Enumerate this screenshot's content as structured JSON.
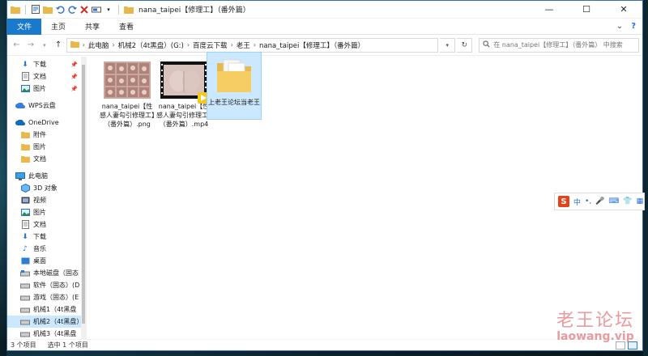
{
  "window": {
    "title": "nana_taipei【修理工】（番外篇）",
    "controls": {
      "minimize": "—",
      "maximize": "☐",
      "close": "✕"
    }
  },
  "ribbon": {
    "tabs": [
      {
        "label": "文件"
      },
      {
        "label": "主页"
      },
      {
        "label": "共享"
      },
      {
        "label": "查看"
      }
    ]
  },
  "address": {
    "breadcrumbs": [
      "此电脑",
      "机械2（4t黑盘）(G:)",
      "百度云下载",
      "老王",
      "nana_taipei【修理工】（番外篇）"
    ],
    "search_placeholder": "在 nana_taipei【修理工】（番外篇） 中搜索"
  },
  "sidebar": {
    "items": [
      {
        "label": "下载",
        "icon": "download-icon",
        "pinned": true
      },
      {
        "label": "文档",
        "icon": "document-icon",
        "pinned": true
      },
      {
        "label": "图片",
        "icon": "picture-icon",
        "pinned": true
      },
      {
        "label": "WPS云盘",
        "icon": "cloud-icon"
      },
      {
        "label": "OneDrive",
        "icon": "onedrive-icon"
      },
      {
        "label": "附件",
        "icon": "folder-icon"
      },
      {
        "label": "图片",
        "icon": "folder-icon"
      },
      {
        "label": "文档",
        "icon": "folder-icon"
      },
      {
        "label": "此电脑",
        "icon": "computer-icon"
      },
      {
        "label": "3D 对象",
        "icon": "3d-objects-icon"
      },
      {
        "label": "视频",
        "icon": "video-icon"
      },
      {
        "label": "图片",
        "icon": "picture-icon"
      },
      {
        "label": "文档",
        "icon": "document-icon"
      },
      {
        "label": "下载",
        "icon": "download-icon"
      },
      {
        "label": "音乐",
        "icon": "music-icon"
      },
      {
        "label": "桌面",
        "icon": "desktop-icon"
      },
      {
        "label": "本地磁盘（固态",
        "icon": "drive-icon"
      },
      {
        "label": "软件（固态）(D",
        "icon": "drive-icon"
      },
      {
        "label": "游戏（固态）(E",
        "icon": "drive-icon"
      },
      {
        "label": "机械1（4t黑盘",
        "icon": "drive-icon"
      },
      {
        "label": "机械2（4t黑盘）",
        "icon": "drive-icon",
        "selected": true
      },
      {
        "label": "机械3（4t黑盘",
        "icon": "drive-icon"
      },
      {
        "label": "网络",
        "icon": "network-icon"
      }
    ]
  },
  "files": [
    {
      "name": "nana_taipei【性感人妻勾引修理工】（番外篇）.png",
      "type": "image"
    },
    {
      "name": "nana_taipei【性感人妻勾引修理工】（番外篇）.mp4",
      "type": "video",
      "badge": "Potplayer"
    },
    {
      "name": "上老王论坛当老王",
      "type": "folder",
      "selected": true
    }
  ],
  "status": {
    "count": "3 个项目",
    "selected": "选中 1 个项目"
  },
  "ime": {
    "logo": "S",
    "mode": "中"
  },
  "watermark": {
    "line1": "老王论坛",
    "line2": "laowang.vip"
  },
  "colors": {
    "accent": "#1979ca",
    "selection": "#cce8ff"
  }
}
